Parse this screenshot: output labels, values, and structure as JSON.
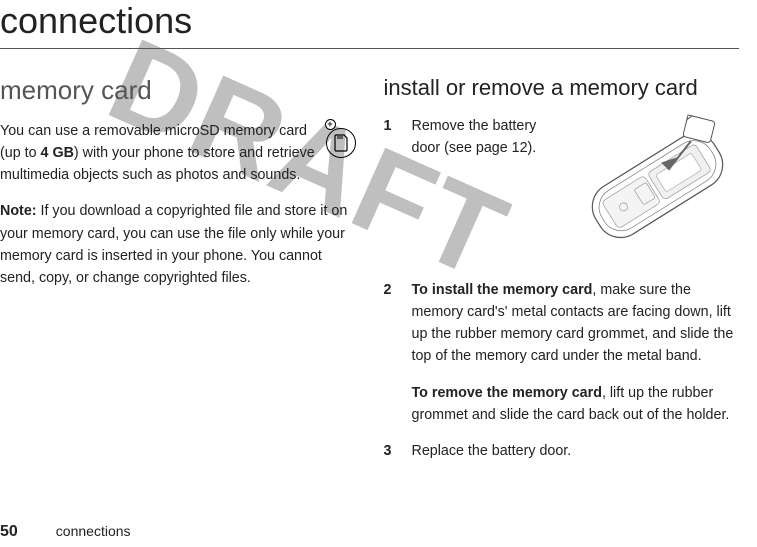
{
  "watermark": "DRAFT",
  "title": "connections",
  "left": {
    "heading": "memory card",
    "intro_before_bold": "You can use a removable microSD memory card (up to ",
    "intro_bold": "4 GB",
    "intro_after_bold": ") with your phone to store and retrieve multimedia objects such as photos and sounds.",
    "note_label": "Note:",
    "note_body": " If you download a copyrighted file and store it on your memory card, you can use the file only while your memory card is inserted in your phone. You cannot send, copy, or change copyrighted files."
  },
  "right": {
    "heading": "install or remove a memory card",
    "step1": "Remove the battery door (see page 12).",
    "step2_bold": "To install the memory card",
    "step2_rest": ", make sure the memory card's' metal contacts are facing down, lift up the rubber memory card grommet, and slide the top of the memory card under the metal band.",
    "step2b_bold": "To remove the memory card",
    "step2b_rest": ", lift up the rubber grommet and slide the card back out of the holder.",
    "step3": "Replace the battery door."
  },
  "footer": {
    "page_num": "50",
    "label": "connections"
  }
}
